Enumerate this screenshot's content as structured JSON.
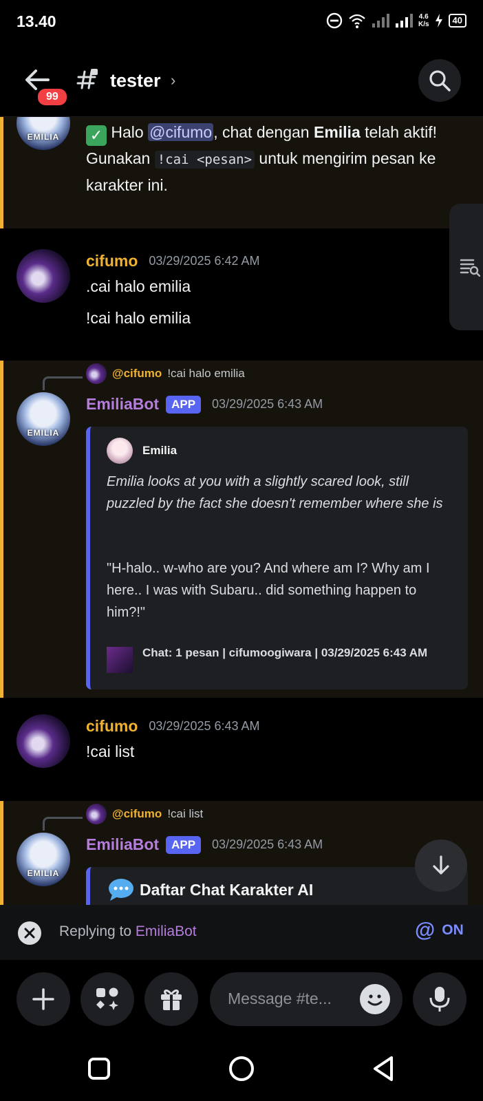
{
  "status_bar": {
    "time": "13.40",
    "net_speed_value": "4.6",
    "net_speed_unit": "K/s",
    "battery": "40"
  },
  "header": {
    "unread_badge": "99",
    "channel_name": "tester",
    "chevron": "›"
  },
  "messages": {
    "m1": {
      "text_prefix": "Halo ",
      "mention": "@cifumo",
      "text_mid": ", chat dengan ",
      "bold_name": "Emilia",
      "text_suffix": " telah aktif!",
      "line2_prefix": "Gunakan ",
      "code": "!cai <pesan>",
      "line2_suffix": " untuk mengirim pesan ke karakter ini."
    },
    "m2": {
      "author": "cifumo",
      "timestamp": "03/29/2025 6:42 AM",
      "line1": ".cai halo emilia",
      "line2": "!cai halo emilia"
    },
    "m3": {
      "reply_name": "@cifumo",
      "reply_text": "!cai halo emilia",
      "author": "EmiliaBot",
      "tag": "APP",
      "timestamp": "03/29/2025 6:43 AM",
      "embed_author": "Emilia",
      "embed_italic": "Emilia looks at you with a slightly scared look, still puzzled by the fact she doesn't remember where she is",
      "embed_text": "\"H-halo.. w-who are you? And where am I? Why am I here.. I was with Subaru.. did something happen to him?!\"",
      "embed_footer": "Chat: 1 pesan | cifumoogiwara | 03/29/2025 6:43 AM"
    },
    "m4": {
      "author": "cifumo",
      "timestamp": "03/29/2025 6:43 AM",
      "line1": "!cai list"
    },
    "m5": {
      "reply_name": "@cifumo",
      "reply_text": "!cai list",
      "author": "EmiliaBot",
      "tag": "APP",
      "timestamp": "03/29/2025 6:43 AM",
      "embed_title": "Daftar Chat Karakter AI"
    }
  },
  "reply_bar": {
    "prefix": "Replying to ",
    "target": "EmiliaBot",
    "ping_label": "ON"
  },
  "composer": {
    "placeholder": "Message #te..."
  },
  "colors": {
    "highlight_border": "#f0b232",
    "blurple": "#5865f2",
    "bot_name": "#b57edc",
    "user_name": "#f0b232"
  },
  "icons": [
    "back-arrow-icon",
    "hash-lock-icon",
    "search-icon",
    "members-list-icon",
    "arrow-down-icon",
    "close-icon",
    "at-icon",
    "plus-icon",
    "apps-icon",
    "gift-icon",
    "emoji-icon",
    "mic-icon",
    "square-nav-icon",
    "circle-nav-icon",
    "triangle-nav-icon",
    "check-emoji-icon",
    "speech-bubble-icon"
  ]
}
